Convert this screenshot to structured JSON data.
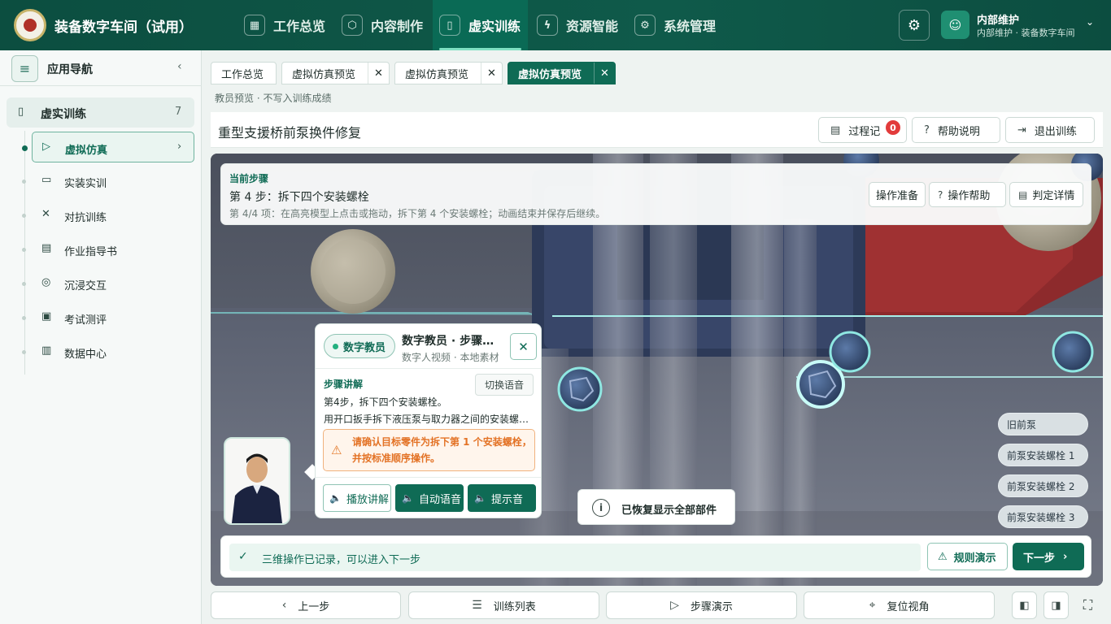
{
  "app": {
    "title": "装备数字车间（试用）"
  },
  "nav": [
    {
      "label": "工作总览",
      "icon": "grid-icon"
    },
    {
      "label": "内容制作",
      "icon": "cube-icon"
    },
    {
      "label": "虚实训练",
      "icon": "book-icon",
      "active": true
    },
    {
      "label": "资源智能",
      "icon": "lightning-icon"
    },
    {
      "label": "系统管理",
      "icon": "gear-icon"
    }
  ],
  "user": {
    "name": "内部维护",
    "subtitle": "内部维护 · 装备数字车间"
  },
  "sidebar": {
    "title": "应用导航",
    "group": {
      "label": "虚实训练",
      "count": "7"
    },
    "items": [
      {
        "label": "虚拟仿真",
        "icon": "play-circle-icon",
        "active": true
      },
      {
        "label": "实装实训",
        "icon": "monitor-icon"
      },
      {
        "label": "对抗训练",
        "icon": "combat-icon"
      },
      {
        "label": "作业指导书",
        "icon": "document-icon"
      },
      {
        "label": "沉浸交互",
        "icon": "vr-headset-icon"
      },
      {
        "label": "考试测评",
        "icon": "clipboard-icon"
      },
      {
        "label": "数据中心",
        "icon": "chart-icon"
      }
    ]
  },
  "tabs": [
    {
      "label": "工作总览",
      "closable": false
    },
    {
      "label": "虚拟仿真预览",
      "closable": true
    },
    {
      "label": "虚拟仿真预览",
      "closable": true
    },
    {
      "label": "虚拟仿真预览",
      "closable": true,
      "active": true
    }
  ],
  "hint": "教员预览 · 不写入训练成绩",
  "page": {
    "title": "重型支援桥前泵换件修复",
    "record_label": "过程记",
    "record_count": "0",
    "help_label": "帮助说明",
    "exit_label": "退出训练"
  },
  "step": {
    "caption": "当前步骤",
    "title": "第 4 步：拆下四个安装螺栓",
    "desc": "第 4/4 项：在高亮模型上点击或拖动，拆下第 4 个安装螺栓；动画结束并保存后继续。",
    "buttons": [
      "操作准备",
      "操作帮助",
      "判定详情"
    ]
  },
  "teacher": {
    "pill": "数字教员",
    "name": "数字教员 · 步骤讲解",
    "sub": "数字人视频 · 本地素材",
    "section": "步骤讲解",
    "switch_label": "切换语音",
    "line1": "第4步，拆下四个安装螺栓。",
    "line2": "用开口扳手拆下液压泵与取力器之间的安装螺栓。",
    "warning": "请确认目标零件为拆下第 1 个安装螺栓，并按标准顺序操作。",
    "btn_play": "播放讲解",
    "btn_auto": "自动语音",
    "btn_tone": "提示音"
  },
  "toast": "已恢复显示全部部件",
  "parts": [
    "旧前泵",
    "前泵安装螺栓 1",
    "前泵安装螺栓 2",
    "前泵安装螺栓 3"
  ],
  "status": {
    "text": "三维操作已记录，可以进入下一步",
    "rule_label": "规则演示",
    "next_label": "下一步"
  },
  "bottom": {
    "prev": "上一步",
    "list": "训练列表",
    "demo": "步骤演示",
    "reset": "复位视角"
  },
  "colors": {
    "primary": "#0f6b55",
    "header": "#0c4e40",
    "warning": "#e37225",
    "badge": "#e23b3b"
  }
}
